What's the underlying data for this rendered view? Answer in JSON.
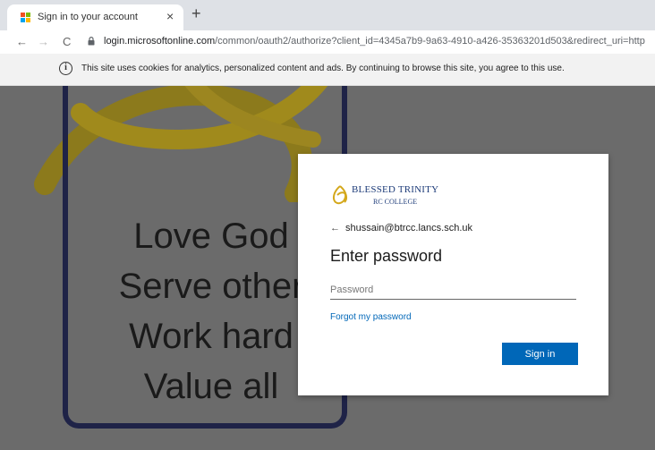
{
  "browser": {
    "tab_title": "Sign in to your account",
    "tab_close": "×",
    "new_tab": "+",
    "back": "←",
    "forward": "→",
    "reload": "C",
    "url_host": "login.microsoftonline.com",
    "url_path": "/common/oauth2/authorize?client_id=4345a7b9-9a63-4910-a426-35363201d503&redirect_uri=http"
  },
  "cookie_banner": {
    "icon": "i",
    "message": "This site uses cookies for analytics, personalized content and ads. By continuing to browse this site, you agree to this use."
  },
  "background": {
    "motto": [
      "Love God",
      "Serve other",
      "Work hard",
      "Value all"
    ]
  },
  "signin": {
    "logo_line1": "BLESSED TRINITY",
    "logo_line2": "RC COLLEGE",
    "back_arrow": "←",
    "identity": "shussain@btrcc.lancs.sch.uk",
    "heading": "Enter password",
    "password_placeholder": "Password",
    "forgot_link": "Forgot my password",
    "submit_label": "Sign in"
  },
  "colors": {
    "accent": "#0067b8",
    "backdrop": "#6b6b6b",
    "frame": "#1f2347",
    "knot": "#c9a81a"
  }
}
